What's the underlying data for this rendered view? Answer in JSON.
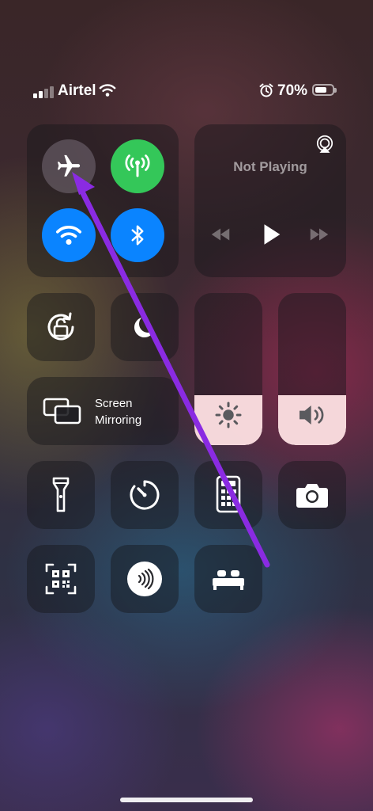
{
  "status_bar": {
    "carrier": "Airtel",
    "signal_bars_filled": 2,
    "signal_bars_total": 4,
    "battery_percent": "70%",
    "battery_level": 0.7,
    "icons": [
      "signal-icon",
      "wifi-icon",
      "alarm-icon",
      "battery-icon"
    ]
  },
  "connectivity": {
    "airplane": {
      "icon": "airplane-icon",
      "state": "off"
    },
    "cellular": {
      "icon": "antenna-icon",
      "state": "on"
    },
    "wifi": {
      "icon": "wifi-icon",
      "state": "on"
    },
    "bluetooth": {
      "icon": "bluetooth-icon",
      "state": "on"
    }
  },
  "now_playing": {
    "label": "Not Playing",
    "icons": [
      "airplay-icon",
      "rewind-icon",
      "play-icon",
      "fast-forward-icon"
    ]
  },
  "controls": {
    "rotation_lock_icon": "rotation-lock-icon",
    "focus_icon": "moon-icon",
    "screen_mirroring": {
      "line1": "Screen",
      "line2": "Mirroring",
      "icon": "screen-mirroring-icon"
    },
    "brightness": {
      "icon": "sun-icon",
      "level": 0.33
    },
    "volume": {
      "icon": "speaker-icon",
      "level": 0.33
    }
  },
  "shortcuts": [
    {
      "icon": "flashlight-icon"
    },
    {
      "icon": "timer-icon"
    },
    {
      "icon": "calculator-icon"
    },
    {
      "icon": "camera-icon"
    },
    {
      "icon": "qr-code-scanner-icon"
    },
    {
      "icon": "nfc-icon"
    },
    {
      "icon": "sleep-bed-icon"
    }
  ],
  "colors": {
    "green": "#34c759",
    "blue": "#0a84ff",
    "annotation_arrow": "#8a2be2",
    "slider_fill": "#ffe1e4"
  }
}
